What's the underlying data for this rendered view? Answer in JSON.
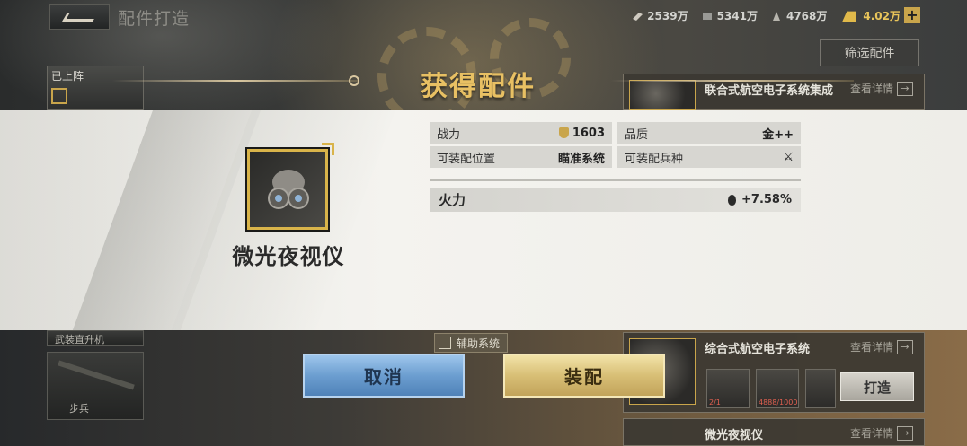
{
  "header": {
    "page_title": "配件打造",
    "filter_label": "筛选配件",
    "resources": [
      {
        "icon": "diamond-stack-icon",
        "value": "2539万"
      },
      {
        "icon": "cube-icon",
        "value": "5341万"
      },
      {
        "icon": "fuel-icon",
        "value": "4768万"
      },
      {
        "icon": "gold-bar-icon",
        "value": "4.02万"
      }
    ],
    "plus_label": "+"
  },
  "left_panel": {
    "deployed_label": "已上阵",
    "cards": [
      {
        "label": "武装直升机"
      },
      {
        "label": "步兵"
      }
    ]
  },
  "right_list": {
    "items": [
      {
        "name": "联合式航空电子系统集成",
        "detail": "查看详情"
      },
      {
        "name": "综合式航空电子系统",
        "detail": "查看详情",
        "craft": "打造",
        "mat_counts": [
          "2/1",
          "4888/1000"
        ]
      },
      {
        "name": "微光夜视仪",
        "detail": "查看详情"
      }
    ]
  },
  "modal": {
    "title": "获得配件",
    "item_name": "微光夜视仪",
    "stats": {
      "power_label": "战力",
      "power_value": "1603",
      "quality_label": "品质",
      "quality_value": "金++",
      "slot_label": "可装配位置",
      "slot_value": "瞄准系统",
      "unit_label": "可装配兵种",
      "unit_value": "⚔"
    },
    "attribute": {
      "label": "火力",
      "value": "+7.58%"
    },
    "category_tag": "辅助系统",
    "cancel_label": "取消",
    "equip_label": "装配"
  },
  "colors": {
    "gold": "#e8c063",
    "cancel_blue": "#6c9ed0",
    "equip_gold": "#d8bf76"
  }
}
